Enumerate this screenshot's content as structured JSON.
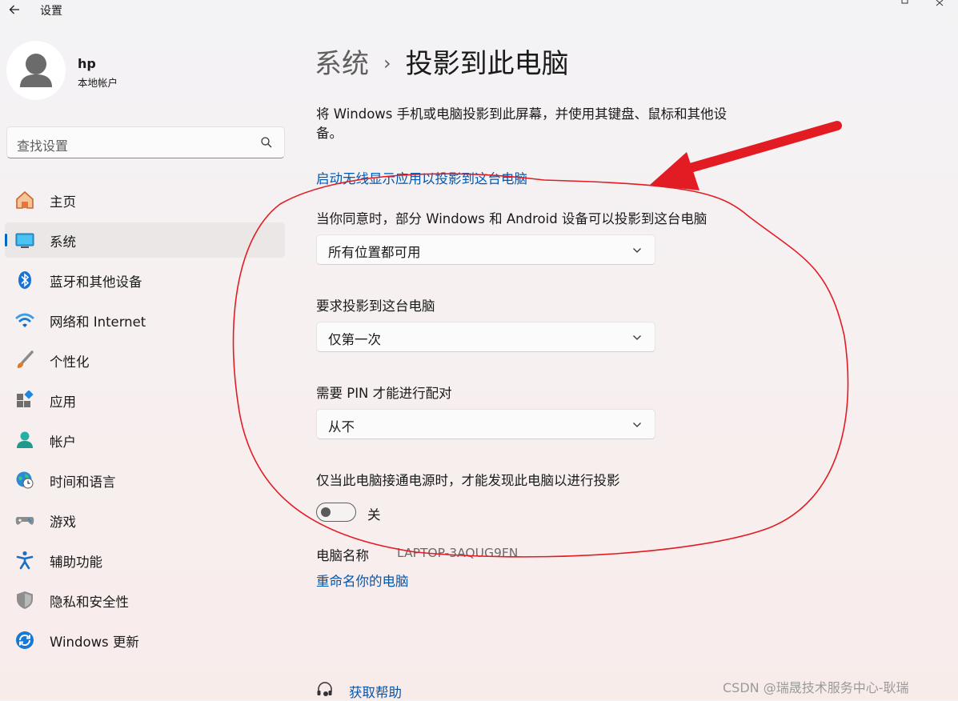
{
  "app": {
    "title": "设置"
  },
  "profile": {
    "name": "hp",
    "account_type": "本地帐户"
  },
  "search": {
    "placeholder": "查找设置"
  },
  "sidebar": {
    "items": [
      {
        "label": "主页",
        "icon": "home-icon"
      },
      {
        "label": "系统",
        "icon": "system-icon",
        "active": true
      },
      {
        "label": "蓝牙和其他设备",
        "icon": "bluetooth-icon"
      },
      {
        "label": "网络和 Internet",
        "icon": "wifi-icon"
      },
      {
        "label": "个性化",
        "icon": "brush-icon"
      },
      {
        "label": "应用",
        "icon": "apps-icon"
      },
      {
        "label": "帐户",
        "icon": "account-icon"
      },
      {
        "label": "时间和语言",
        "icon": "globe-clock-icon"
      },
      {
        "label": "游戏",
        "icon": "gamepad-icon"
      },
      {
        "label": "辅助功能",
        "icon": "accessibility-icon"
      },
      {
        "label": "隐私和安全性",
        "icon": "shield-icon"
      },
      {
        "label": "Windows 更新",
        "icon": "update-icon"
      }
    ]
  },
  "main": {
    "breadcrumb": {
      "parent": "系统",
      "separator": "›",
      "current": "投影到此电脑"
    },
    "description_line1": "将 Windows 手机或电脑投影到此屏幕，并使用其键盘、鼠标和其他设",
    "description_line2": "备。",
    "launch_link": "启动无线显示应用以投影到这台电脑",
    "setting1": {
      "label": "当你同意时，部分 Windows 和 Android 设备可以投影到这台电脑",
      "value": "所有位置都可用"
    },
    "setting2": {
      "label": "要求投影到这台电脑",
      "value": "仅第一次"
    },
    "setting3": {
      "label": "需要 PIN 才能进行配对",
      "value": "从不"
    },
    "power_setting": {
      "label": "仅当此电脑接通电源时，才能发现此电脑以进行投影",
      "state_label": "关",
      "on": false
    },
    "pc_name": {
      "label": "电脑名称",
      "value": "LAPTOP-3AQUG9FN"
    },
    "rename_link": "重命名你的电脑",
    "help_link": "获取帮助"
  },
  "watermark": "CSDN @瑞晟技术服务中心-耿瑞",
  "colors": {
    "accent": "#0067c0",
    "link": "#0057b0",
    "annotation": "#e31b23"
  }
}
